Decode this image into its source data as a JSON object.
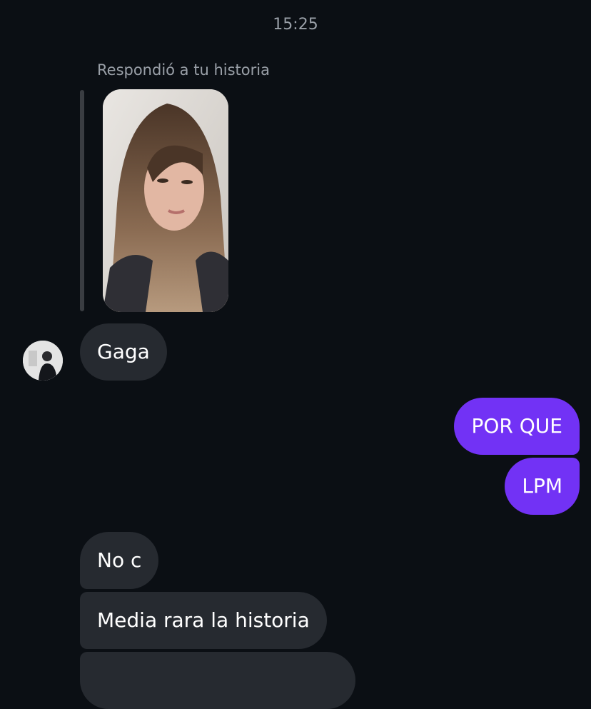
{
  "conversation": {
    "timestamp": "15:25",
    "reply_context": {
      "label": "Respondió a tu historia",
      "story_thumbnail": "story-photo"
    },
    "messages": [
      {
        "direction": "incoming",
        "text": "Gaga",
        "has_avatar": true
      },
      {
        "direction": "outgoing",
        "text": "POR QUE"
      },
      {
        "direction": "outgoing",
        "text": "LPM"
      },
      {
        "direction": "incoming",
        "text": "No c"
      },
      {
        "direction": "incoming",
        "text": "Media rara la historia"
      },
      {
        "direction": "incoming",
        "text": ""
      }
    ]
  },
  "colors": {
    "background": "#0b0f14",
    "incoming_bubble": "#262a30",
    "outgoing_bubble": "#7232f5",
    "secondary_text": "#9aa0a8"
  }
}
